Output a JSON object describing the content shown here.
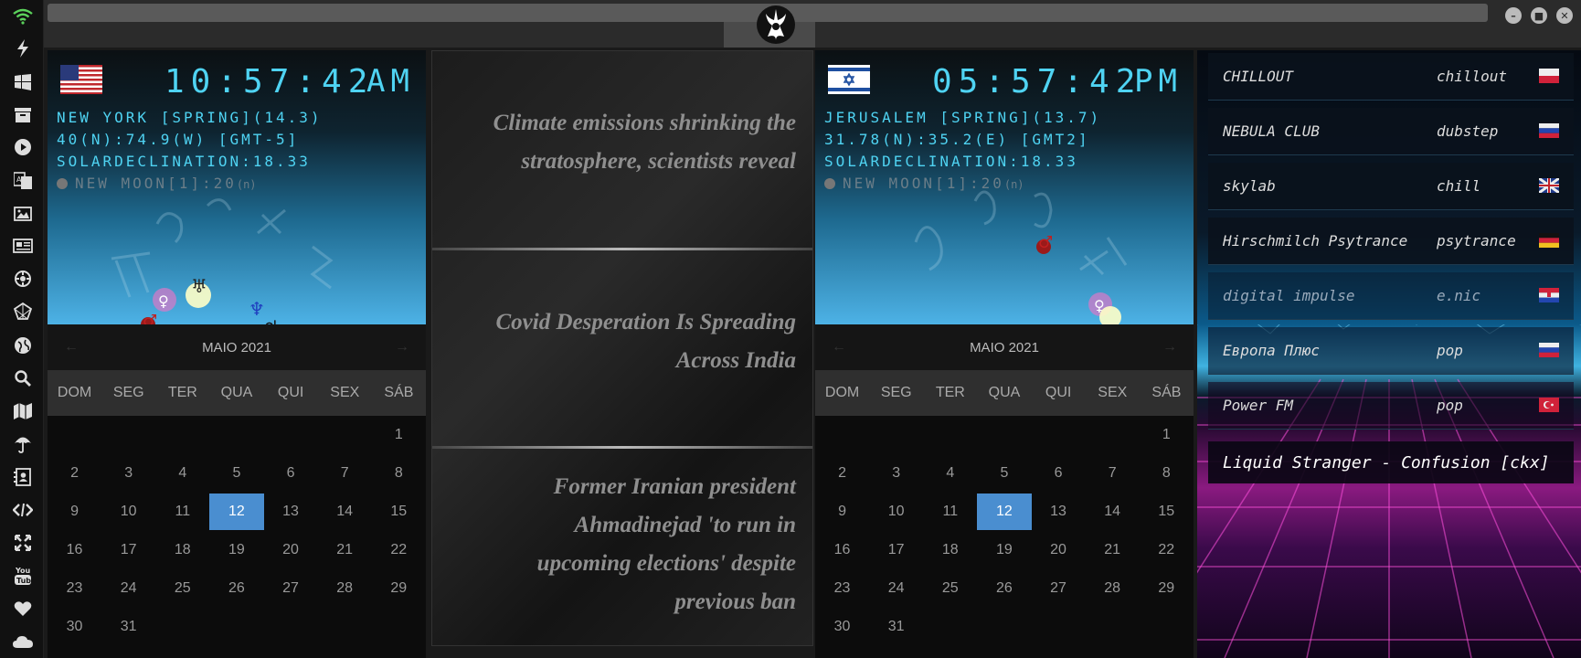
{
  "sidebar": {
    "icons": [
      "wifi-icon",
      "bolt-icon",
      "windows-icon",
      "archive-icon",
      "play-icon",
      "translate-icon",
      "image-icon",
      "news-icon",
      "settings-gear-icon",
      "network-icon",
      "globe-icon",
      "search-icon",
      "map-icon",
      "umbrella-icon",
      "contacts-icon",
      "code-icon",
      "expand-icon",
      "youtube-icon",
      "heart-icon",
      "cloud-icon"
    ]
  },
  "titlebar": {
    "logo_icon": "rebel-alliance-logo-icon",
    "controls": [
      "minimize-icon",
      "maximize-icon",
      "close-icon"
    ]
  },
  "clocks": [
    {
      "flag": "us-flag-icon",
      "time": "10:57:42",
      "ampm": "AM",
      "line1": "NEW YORK [SPRING](14.3)",
      "line2": "40(N):74.9(W) [GMT-5]",
      "line3": "SOLARDECLINATION:18.33",
      "moon": "NEW MOON[1]:20",
      "moon_suffix": "(n)"
    },
    {
      "flag": "israel-flag-icon",
      "time": "05:57:42",
      "ampm": "PM",
      "line1": "JERUSALEM [SPRING](13.7)",
      "line2": "31.78(N):35.2(E) [GMT2]",
      "line3": "SOLARDECLINATION:18.33",
      "moon": "NEW MOON[1]:20",
      "moon_suffix": "(n)"
    }
  ],
  "calendar": {
    "month_label": "MAIO 2021",
    "weekdays": [
      "DOM",
      "SEG",
      "TER",
      "QUA",
      "QUI",
      "SEX",
      "SÁB"
    ],
    "first_weekday_index": 6,
    "days_in_month": 31,
    "today": 12,
    "prev_icon": "chevron-left-icon",
    "next_icon": "chevron-right-icon"
  },
  "news": [
    "Climate emissions shrinking the stratosphere, scientists reveal",
    "Covid Desperation Is Spreading Across India",
    "Former Iranian president Ahmadinejad 'to run in upcoming elections' despite previous ban"
  ],
  "radio": {
    "stations": [
      {
        "name": "CHILLOUT",
        "genre": "chillout",
        "flag": "poland-flag-icon"
      },
      {
        "name": "NEBULA CLUB",
        "genre": "dubstep",
        "flag": "russia-flag-icon"
      },
      {
        "name": "skylab",
        "genre": "chill",
        "flag": "uk-flag-icon"
      },
      {
        "name": "Hirschmilch Psytrance",
        "genre": "psytrance",
        "flag": "germany-flag-icon"
      },
      {
        "name": "digital impulse",
        "genre": "e.nic",
        "flag": "croatia-flag-icon"
      },
      {
        "name": "Европа Плюс",
        "genre": "pop",
        "flag": "russia-flag-icon"
      },
      {
        "name": "Power FM",
        "genre": "pop",
        "flag": "turkey-flag-icon"
      }
    ],
    "now_playing": "Liquid Stranger - Confusion [ckx]"
  }
}
